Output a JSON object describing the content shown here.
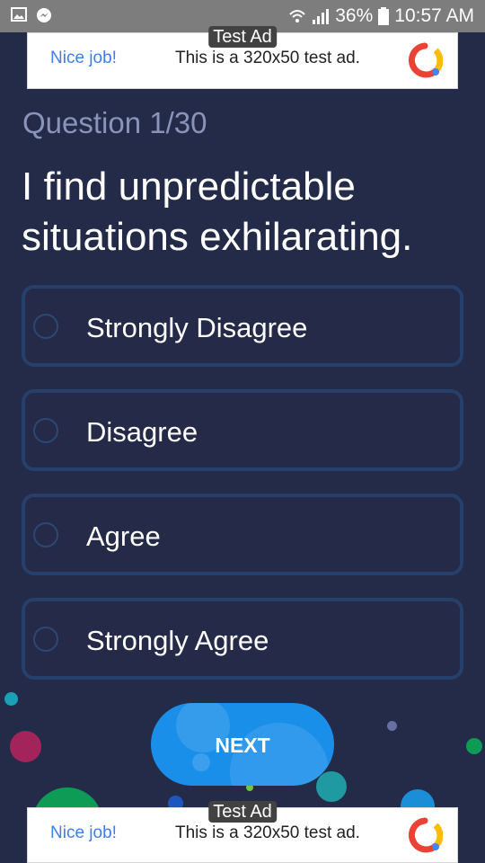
{
  "status_bar": {
    "battery_percent": "36%",
    "time": "10:57 AM",
    "icons": [
      "image-icon",
      "messenger-icon",
      "wifi-icon",
      "signal-icon",
      "battery-icon"
    ]
  },
  "ads": {
    "badge": "Test Ad",
    "nice_job": "Nice job!",
    "text": "This is a 320x50 test ad."
  },
  "quiz": {
    "progress": "Question 1/30",
    "question": "I find unpredictable situations exhilarating.",
    "options": [
      "Strongly Disagree",
      "Disagree",
      "Agree",
      "Strongly Agree"
    ],
    "next_label": "NEXT"
  },
  "colors": {
    "background": "#232b48",
    "option_border": "#263f6b",
    "next_button": "#1a8fea",
    "question_label": "#8a93b8"
  }
}
